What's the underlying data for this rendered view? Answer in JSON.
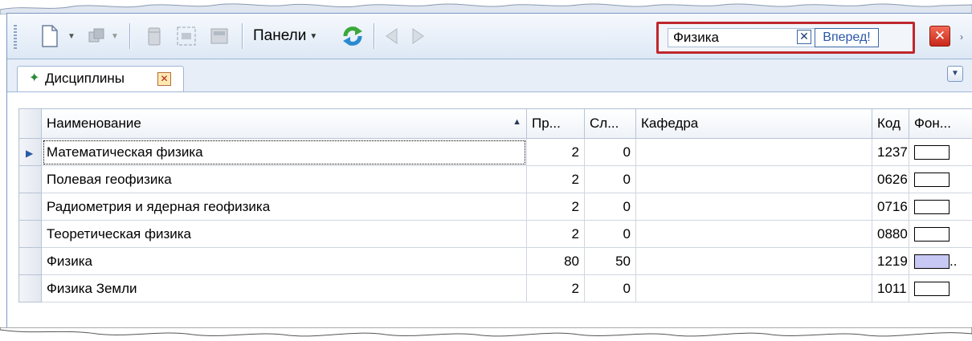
{
  "toolbar": {
    "panels_label": "Панели",
    "search": {
      "value": "Физика",
      "clear_glyph": "✕",
      "go_label": "Вперед!"
    },
    "close_glyph": "✕",
    "overflow_glyph": "›"
  },
  "tabs": [
    {
      "label": "Дисциплины",
      "icon": "plus-icon",
      "close_glyph": "✕"
    }
  ],
  "tab_menu_glyph": "▼",
  "grid": {
    "columns": [
      "Наименование",
      "Пр...",
      "Сл...",
      "Кафедра",
      "Код",
      "Фон..."
    ],
    "sort_glyph": "▲",
    "rows": [
      {
        "name": "Математическая физика",
        "pr": "2",
        "sl": "0",
        "kafedra": "",
        "kod": "1237",
        "color": "#ffffff",
        "current": true
      },
      {
        "name": "Полевая геофизика",
        "pr": "2",
        "sl": "0",
        "kafedra": "",
        "kod": "0626",
        "color": "#ffffff"
      },
      {
        "name": "Радиометрия и ядерная геофизика",
        "pr": "2",
        "sl": "0",
        "kafedra": "",
        "kod": "0716",
        "color": "#ffffff"
      },
      {
        "name": "Теоретическая физика",
        "pr": "2",
        "sl": "0",
        "kafedra": "",
        "kod": "0880",
        "color": "#ffffff"
      },
      {
        "name": "Физика",
        "pr": "80",
        "sl": "50",
        "kafedra": "",
        "kod": "1219",
        "color": "#c8c8f4",
        "ellipsis": ".."
      },
      {
        "name": "Физика Земли",
        "pr": "2",
        "sl": "0",
        "kafedra": "",
        "kod": "1011",
        "color": "#ffffff"
      }
    ]
  },
  "colors": {
    "accent": "#c0262d",
    "header_border": "#9fb6d6",
    "link_blue": "#2a58a8"
  }
}
